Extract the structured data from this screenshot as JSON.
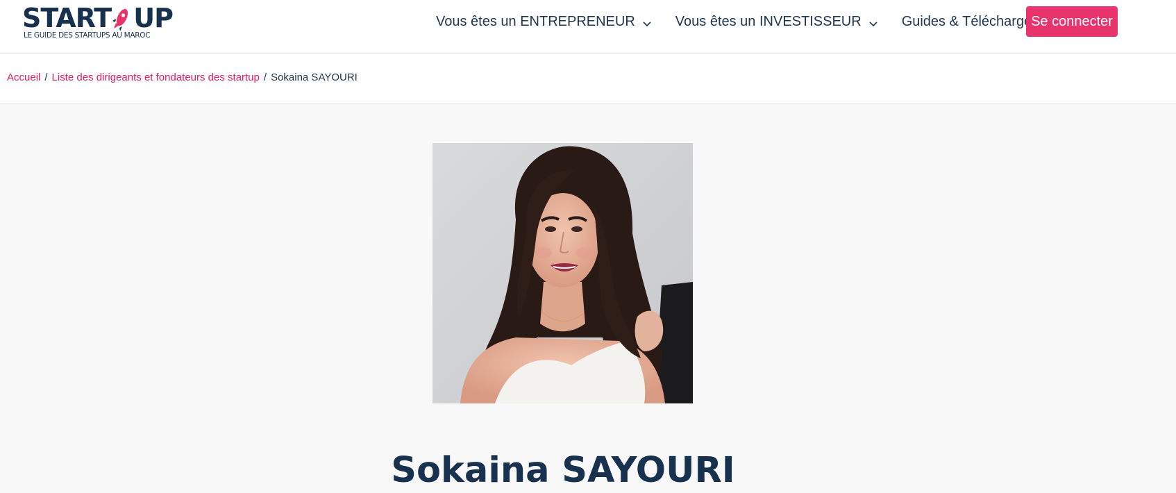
{
  "logo": {
    "text_before": "START",
    "text_after": "UP",
    "tagline": "LE GUIDE DES STARTUPS AU MAROC",
    "rocket_icon": "rocket-icon",
    "brand_color": "#e8336c",
    "text_color": "#17314f"
  },
  "nav": {
    "items": [
      {
        "label": "Vous êtes un ENTREPRENEUR",
        "icon": "chevron-down-icon"
      },
      {
        "label": "Vous êtes un INVESTISSEUR",
        "icon": "chevron-down-icon"
      },
      {
        "label": "Guides & Téléchargement",
        "icon": "chevron-down-icon"
      }
    ],
    "login_label": "Se connecter"
  },
  "breadcrumb": {
    "home": "Accueil",
    "list": "Liste des dirigeants et fondateurs des startup",
    "current": "Sokaina SAYOURI",
    "separator": "/"
  },
  "profile": {
    "name": "Sokaina SAYOURI"
  },
  "colors": {
    "accent": "#e8336c",
    "link": "#e21a61",
    "heading": "#17314f",
    "background": "#f8f8f8"
  }
}
